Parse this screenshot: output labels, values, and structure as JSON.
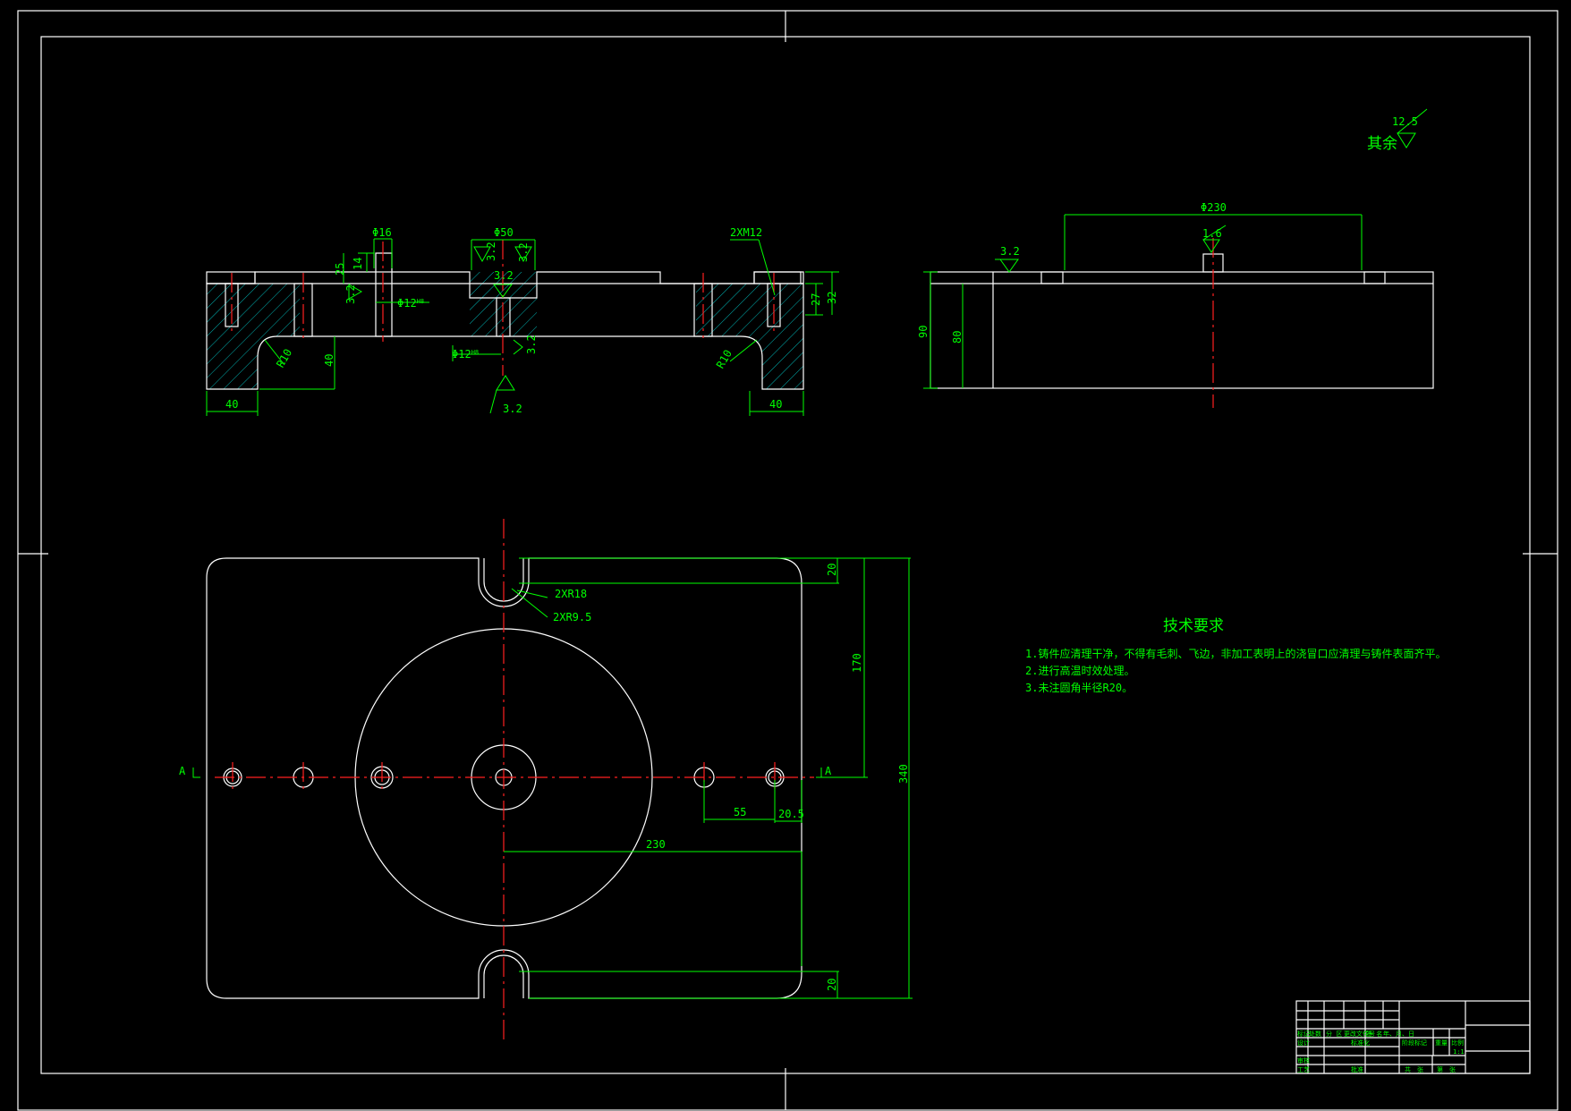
{
  "colors": {
    "background": "#000000",
    "outline": "#ffffff",
    "dimension": "#00ff00",
    "centerline": "#ff2020",
    "hatch": "#00c8c8"
  },
  "roughness_note": {
    "label": "其余",
    "value": "12.5"
  },
  "section_view": {
    "dims": {
      "phi16": "Φ16",
      "phi50": "Φ50",
      "thread": "2XM12",
      "depth14": "14",
      "depth25": "25",
      "ra_a": "3.2",
      "ra_b": "3.2",
      "ra_c": "3.2",
      "ra_d": "3.2",
      "phi12_top": "Φ12",
      "phi12_top_tol": "H8",
      "phi12_bot": "Φ12",
      "phi12_bot_tol": "H8",
      "h27": "27",
      "h32": "32",
      "r10_left": "R10",
      "r10_right": "R10",
      "h40": "40",
      "w40_left": "40",
      "w40_right": "40",
      "ra_bottom": "3.2"
    }
  },
  "side_view": {
    "dims": {
      "phi230": "Φ230",
      "ra_top": "1.6",
      "ra_left": "3.2",
      "h90": "90",
      "h80": "80"
    }
  },
  "plan_view": {
    "dims": {
      "slot_r18": "2XR18",
      "slot_r95": "2XR9.5",
      "d20_top": "20",
      "d170": "170",
      "d340": "340",
      "d55": "55",
      "d205": "20.5",
      "d230": "230",
      "d20_bottom": "20",
      "section_left": "A",
      "section_right": "A"
    }
  },
  "tech_requirements": {
    "title": "技术要求",
    "items": [
      "1.铸件应清理干净，不得有毛刺、飞边，非加工表明上的浇冒口应清理与铸件表面齐平。",
      "2.进行高温时效处理。",
      "3.未注圆角半径R20。"
    ]
  },
  "title_block": {
    "row1": [
      "标记",
      "处数",
      "分 区",
      "更改文件号",
      "签 名",
      "年、月、日"
    ],
    "design": "设计",
    "standardize": "标准化",
    "review": "审核",
    "process": "工艺",
    "approve": "批准",
    "stage_mark": "阶段标记",
    "weight": "重量",
    "scale": "比例",
    "scale_value": "1:1",
    "sheet_total": "共　张",
    "sheet_no": "第　张"
  }
}
